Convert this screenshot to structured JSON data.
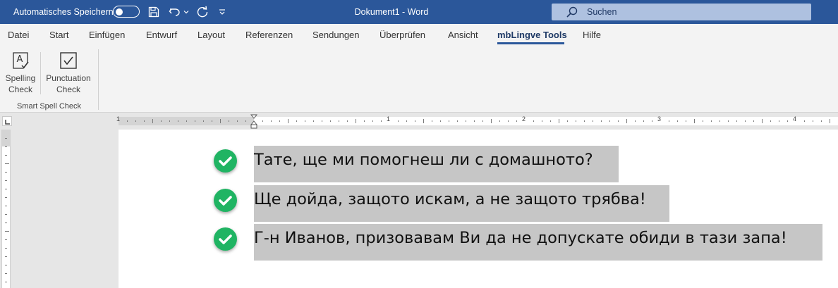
{
  "titlebar": {
    "autosave_label": "Automatisches Speichern",
    "doc_title": "Dokument1  -  Word",
    "search_placeholder": "Suchen"
  },
  "tabs": [
    {
      "label": "Datei"
    },
    {
      "label": "Start"
    },
    {
      "label": "Einfügen"
    },
    {
      "label": "Entwurf"
    },
    {
      "label": "Layout"
    },
    {
      "label": "Referenzen"
    },
    {
      "label": "Sendungen"
    },
    {
      "label": "Überprüfen"
    },
    {
      "label": "Ansicht"
    },
    {
      "label": "mbLingve Tools"
    },
    {
      "label": "Hilfe"
    }
  ],
  "ribbon": {
    "spelling": {
      "line1": "Spelling",
      "line2": "Check"
    },
    "punctuation": {
      "line1": "Punctuation",
      "line2": "Check"
    },
    "group_label": "Smart Spell Check"
  },
  "ruler": {
    "numbers": [
      "1",
      "1",
      "2",
      "3",
      "4"
    ]
  },
  "document": {
    "lines": [
      {
        "text": "Тате, ще ми помогнеш ли с домашното?"
      },
      {
        "text": "Ще дойда, защото искам, а не защото трябва!"
      },
      {
        "text": "Г-н Иванов, призовавам Ви да не допускате обиди в тази запа!"
      }
    ]
  },
  "colors": {
    "titlebar": "#2b579a",
    "check_green": "#20b463",
    "highlight": "#c6c6c6"
  }
}
